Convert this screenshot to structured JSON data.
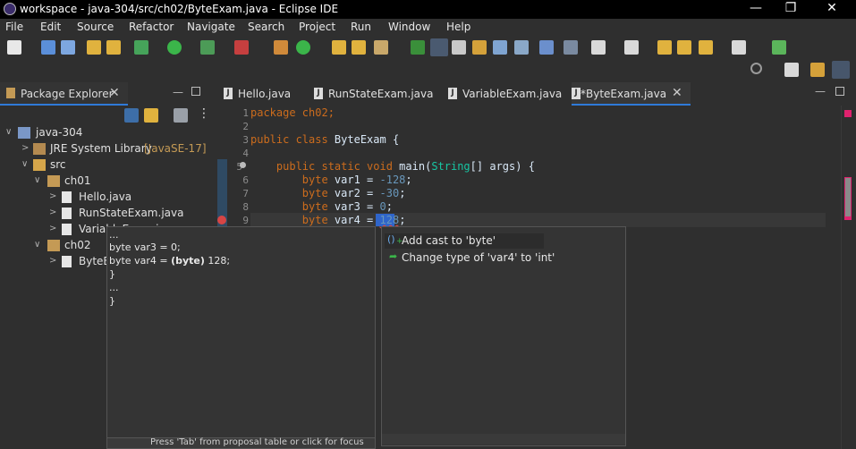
{
  "window": {
    "title": "workspace - java-304/src/ch02/ByteExam.java - Eclipse IDE",
    "controls": [
      "—",
      "❐",
      "✕"
    ]
  },
  "menubar": [
    "File",
    "Edit",
    "Source",
    "Refactor",
    "Navigate",
    "Search",
    "Project",
    "Run",
    "Window",
    "Help"
  ],
  "package_explorer": {
    "tab_label": "Package Explorer",
    "tree": [
      {
        "twisty": "∨",
        "label": "java-304",
        "icon": "java-project-icon"
      },
      {
        "twisty": ">",
        "label": "JRE System Library",
        "decoration": "[JavaSE-17]",
        "icon": "library-icon"
      },
      {
        "twisty": "∨",
        "label": "src",
        "icon": "source-folder-icon"
      },
      {
        "twisty": "∨",
        "label": "ch01",
        "icon": "package-icon"
      },
      {
        "twisty": ">",
        "label": "Hello.java",
        "icon": "java-file-icon"
      },
      {
        "twisty": ">",
        "label": "RunStateExam.java",
        "icon": "java-file-icon"
      },
      {
        "twisty": ">",
        "label": "VariableExam.java",
        "icon": "java-file-icon"
      },
      {
        "twisty": "∨",
        "label": "ch02",
        "icon": "package-icon"
      },
      {
        "twisty": ">",
        "label": "ByteExam.java",
        "icon": "java-file-icon"
      }
    ]
  },
  "editor_tabs": [
    {
      "label": "Hello.java"
    },
    {
      "label": "RunStateExam.java"
    },
    {
      "label": "VariableExam.java"
    },
    {
      "label": "*ByteExam.java",
      "active": true
    }
  ],
  "code": {
    "line_numbers": [
      "1",
      "2",
      "3",
      "4",
      "5",
      "6",
      "7",
      "8",
      "9"
    ],
    "pkg": "package ch02;",
    "cls_kw": "public class",
    "cls_name": " ByteExam {",
    "main_kw": "public static void",
    "main_rest": " main(",
    "main_type": "String",
    "main_args": "[] args) {",
    "var1": {
      "kw": "byte",
      "rest": " var1 = ",
      "num": "-128",
      "end": ";"
    },
    "var2": {
      "kw": "byte",
      "rest": " var2 = ",
      "num": "-30",
      "end": ";"
    },
    "var3": {
      "kw": "byte",
      "rest": " var3 = ",
      "num": "0",
      "end": ";"
    },
    "var4": {
      "kw": "byte",
      "rest": " var4 = ",
      "num": "128",
      "end": ";"
    }
  },
  "quickfix": {
    "proposals": [
      {
        "label": "Add cast to 'byte'",
        "icon": "cast-icon"
      },
      {
        "label": "Change type of 'var4' to 'int'",
        "icon": "change-type-icon"
      }
    ],
    "preview_lines": [
      "...",
      "byte var3 = 0;",
      "byte var4 = ",
      "(byte)",
      " 128;",
      "}",
      "...",
      "}"
    ],
    "footer": "Press 'Tab' from proposal table or click for focus"
  }
}
